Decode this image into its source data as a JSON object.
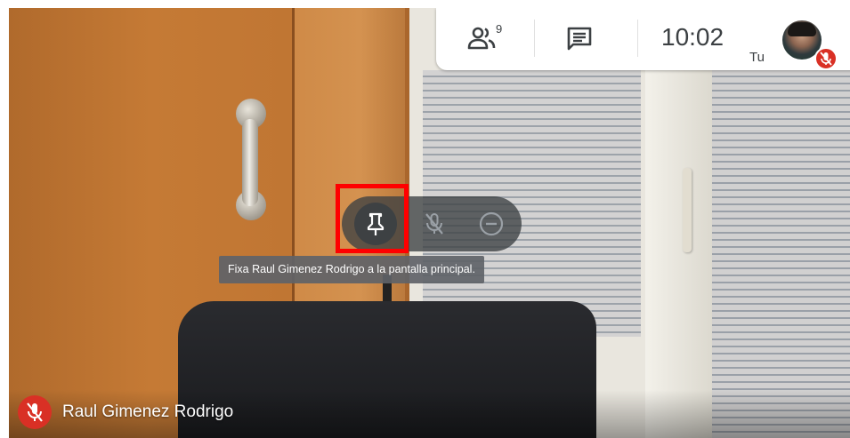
{
  "topbar": {
    "participants_icon": "people-icon",
    "participants_count": "9",
    "chat_icon": "chat-icon",
    "time": "10:02",
    "self_label": "Tu",
    "self_avatar": "avatar",
    "self_mic_status": "mic-off-icon"
  },
  "tile_controls": {
    "pin_icon": "pin-icon",
    "mute_icon": "mic-off-icon",
    "remove_icon": "remove-icon",
    "tooltip": "Fixa Raul Gimenez Rodrigo a la pantalla principal."
  },
  "participant": {
    "name": "Raul Gimenez Rodrigo",
    "mic_status": "mic-off-icon"
  },
  "colors": {
    "mic_off_red": "#d93025",
    "highlight_red": "#ff0000",
    "control_pill": "#3c4043",
    "topbar_bg": "#ffffff"
  }
}
